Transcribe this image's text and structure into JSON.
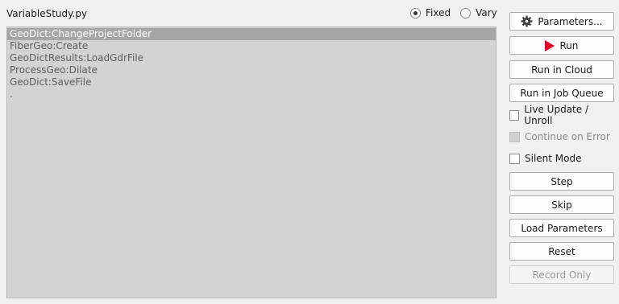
{
  "window": {
    "title": "VariableStudy.py"
  },
  "mode": {
    "options": [
      {
        "label": "Fixed",
        "selected": true
      },
      {
        "label": "Vary",
        "selected": false
      }
    ]
  },
  "steps": {
    "items": [
      {
        "label": "GeoDict:ChangeProjectFolder",
        "selected": true
      },
      {
        "label": "FiberGeo:Create",
        "selected": false
      },
      {
        "label": "GeoDictResults:LoadGdrFile",
        "selected": false
      },
      {
        "label": "ProcessGeo:Dilate",
        "selected": false
      },
      {
        "label": "GeoDict:SaveFile",
        "selected": false
      },
      {
        "label": ".",
        "selected": false
      }
    ]
  },
  "sidebar": {
    "parameters_label": "Parameters...",
    "parameters_icon": "gear-icon",
    "run_label": "Run",
    "run_icon": "play-icon",
    "run_icon_color": "#e0002a",
    "run_in_cloud_label": "Run in Cloud",
    "run_in_job_queue_label": "Run in Job Queue",
    "live_update_label": "Live Update / Unroll",
    "live_update_checked": false,
    "continue_on_error_label": "Continue on Error",
    "continue_on_error_checked": false,
    "continue_on_error_enabled": false,
    "silent_mode_label": "Silent Mode",
    "silent_mode_checked": false,
    "step_label": "Step",
    "skip_label": "Skip",
    "load_parameters_label": "Load Parameters",
    "reset_label": "Reset",
    "record_only_label": "Record Only",
    "record_only_enabled": false
  }
}
